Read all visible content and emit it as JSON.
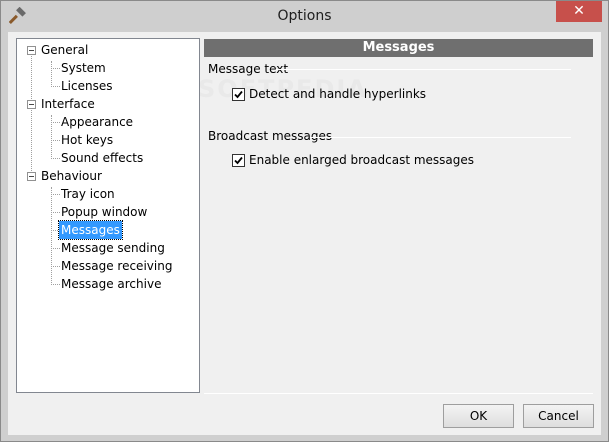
{
  "window": {
    "title": "Options",
    "close_glyph": "✕",
    "app_icon": "hammer-icon"
  },
  "tree": {
    "nodes": [
      {
        "label": "General",
        "children": [
          "System",
          "Licenses"
        ]
      },
      {
        "label": "Interface",
        "children": [
          "Appearance",
          "Hot keys",
          "Sound effects"
        ]
      },
      {
        "label": "Behaviour",
        "children": [
          "Tray icon",
          "Popup window",
          "Messages",
          "Message sending",
          "Message receiving",
          "Message archive"
        ]
      }
    ],
    "selected": "Messages"
  },
  "pane": {
    "header": "Messages",
    "groups": [
      {
        "label": "Message text",
        "options": [
          {
            "label": "Detect and handle hyperlinks",
            "checked": true
          }
        ]
      },
      {
        "label": "Broadcast messages",
        "options": [
          {
            "label": "Enable enlarged broadcast messages",
            "checked": true
          }
        ]
      }
    ]
  },
  "watermark": "SOFTPEDIA",
  "buttons": {
    "ok": "OK",
    "cancel": "Cancel"
  },
  "colors": {
    "header_bg": "#6f6f6f",
    "selection": "#3399ff",
    "close_btn": "#c7504b"
  }
}
